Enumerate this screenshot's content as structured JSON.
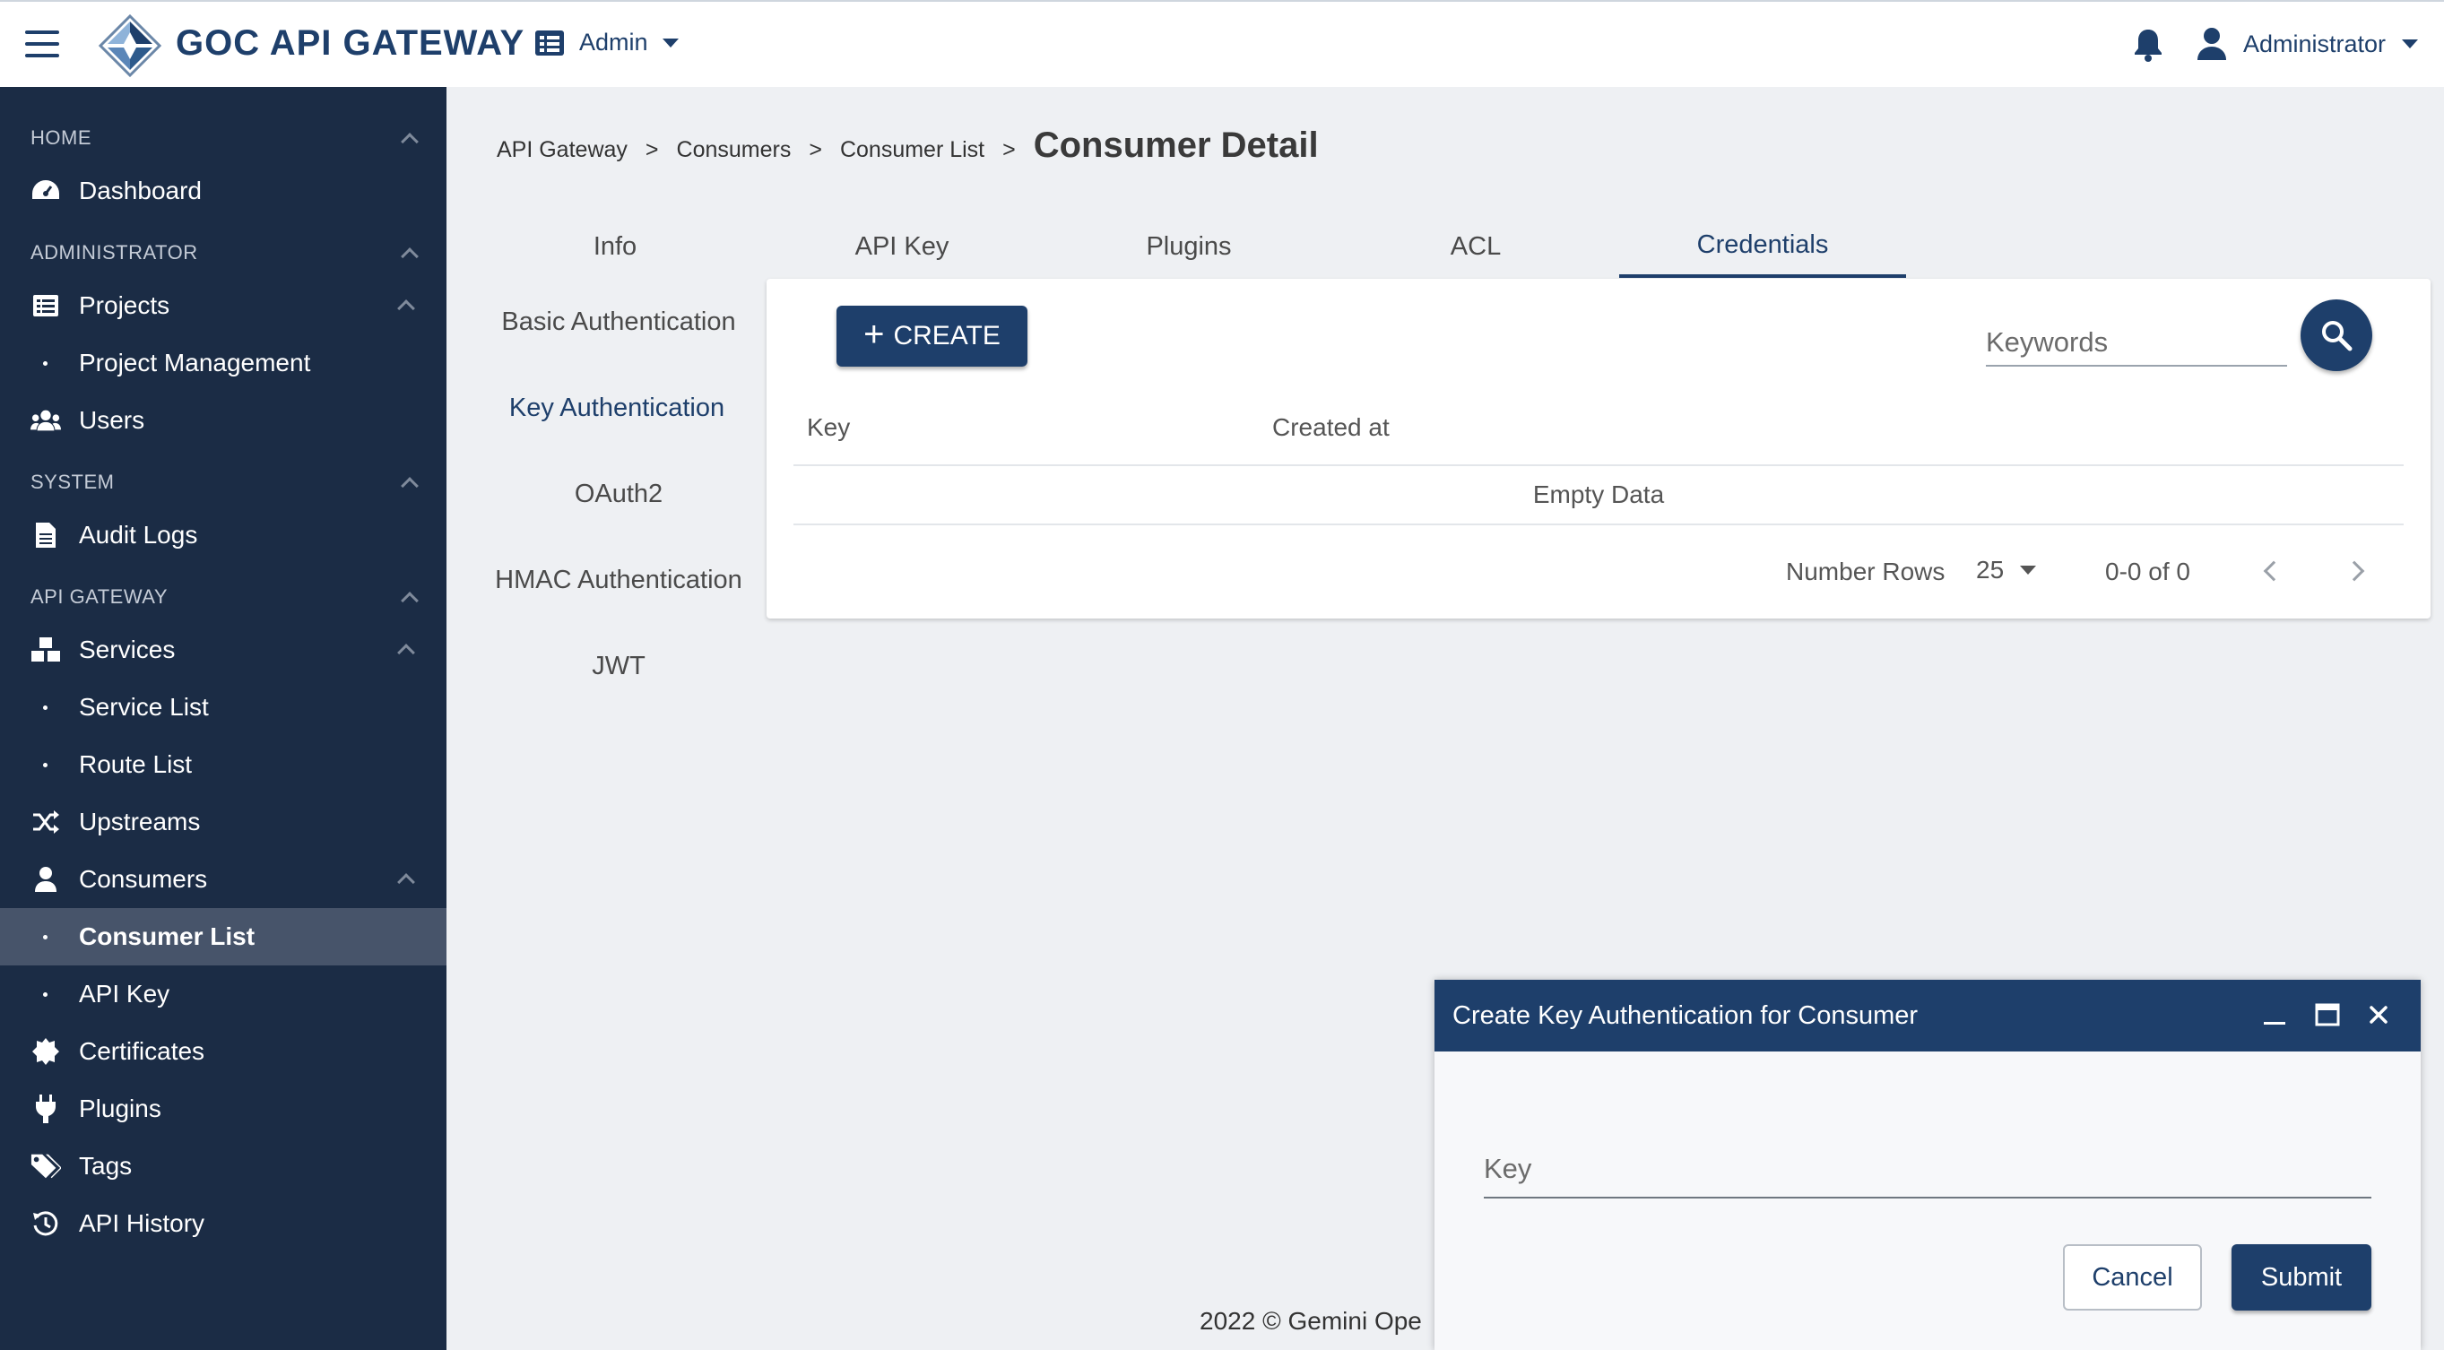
{
  "header": {
    "brand": "GOC API GATEWAY",
    "role_select": "Admin",
    "user_name": "Administrator"
  },
  "sidebar": {
    "sections": [
      {
        "title": "HOME"
      },
      {
        "title": "ADMINISTRATOR"
      },
      {
        "title": "SYSTEM"
      },
      {
        "title": "API GATEWAY"
      }
    ],
    "items": [
      {
        "label": "Dashboard",
        "icon": "dashboard-icon"
      },
      {
        "label": "Projects",
        "icon": "list-icon"
      },
      {
        "label": "Project Management"
      },
      {
        "label": "Users",
        "icon": "users-icon"
      },
      {
        "label": "Audit Logs",
        "icon": "document-icon"
      },
      {
        "label": "Services",
        "icon": "cubes-icon"
      },
      {
        "label": "Service List"
      },
      {
        "label": "Route List"
      },
      {
        "label": "Upstreams",
        "icon": "shuffle-icon"
      },
      {
        "label": "Consumers",
        "icon": "user-icon"
      },
      {
        "label": "Consumer List",
        "active": true
      },
      {
        "label": "API Key"
      },
      {
        "label": "Certificates",
        "icon": "certificate-icon"
      },
      {
        "label": "Plugins",
        "icon": "plug-icon"
      },
      {
        "label": "Tags",
        "icon": "tags-icon"
      },
      {
        "label": "API History",
        "icon": "history-icon"
      }
    ]
  },
  "breadcrumb": {
    "items": [
      "API Gateway",
      "Consumers",
      "Consumer List"
    ],
    "separator": ">",
    "current": "Consumer Detail"
  },
  "tabs": [
    "Info",
    "API Key",
    "Plugins",
    "ACL",
    "Credentials"
  ],
  "active_tab": "Credentials",
  "side_tabs": [
    "Basic Authentication",
    "Key Authentication",
    "OAuth2",
    "HMAC Authentication",
    "JWT"
  ],
  "active_side_tab": "Key Authentication",
  "toolbar": {
    "create_label": "CREATE",
    "search_placeholder": "Keywords"
  },
  "table": {
    "columns": [
      "Key",
      "Created at"
    ],
    "empty_text": "Empty Data"
  },
  "pagination": {
    "rows_label": "Number Rows",
    "rows_value": "25",
    "range": "0-0 of 0"
  },
  "footer": {
    "text": "2022 © Gemini Ope"
  },
  "modal": {
    "title": "Create Key Authentication for Consumer",
    "key_placeholder": "Key",
    "cancel_label": "Cancel",
    "submit_label": "Submit"
  },
  "colors": {
    "primary": "#1e3f6b",
    "sidebar_bg": "#1b2c45",
    "sidebar_active": "#47546a",
    "page_bg": "#eef0f3"
  }
}
